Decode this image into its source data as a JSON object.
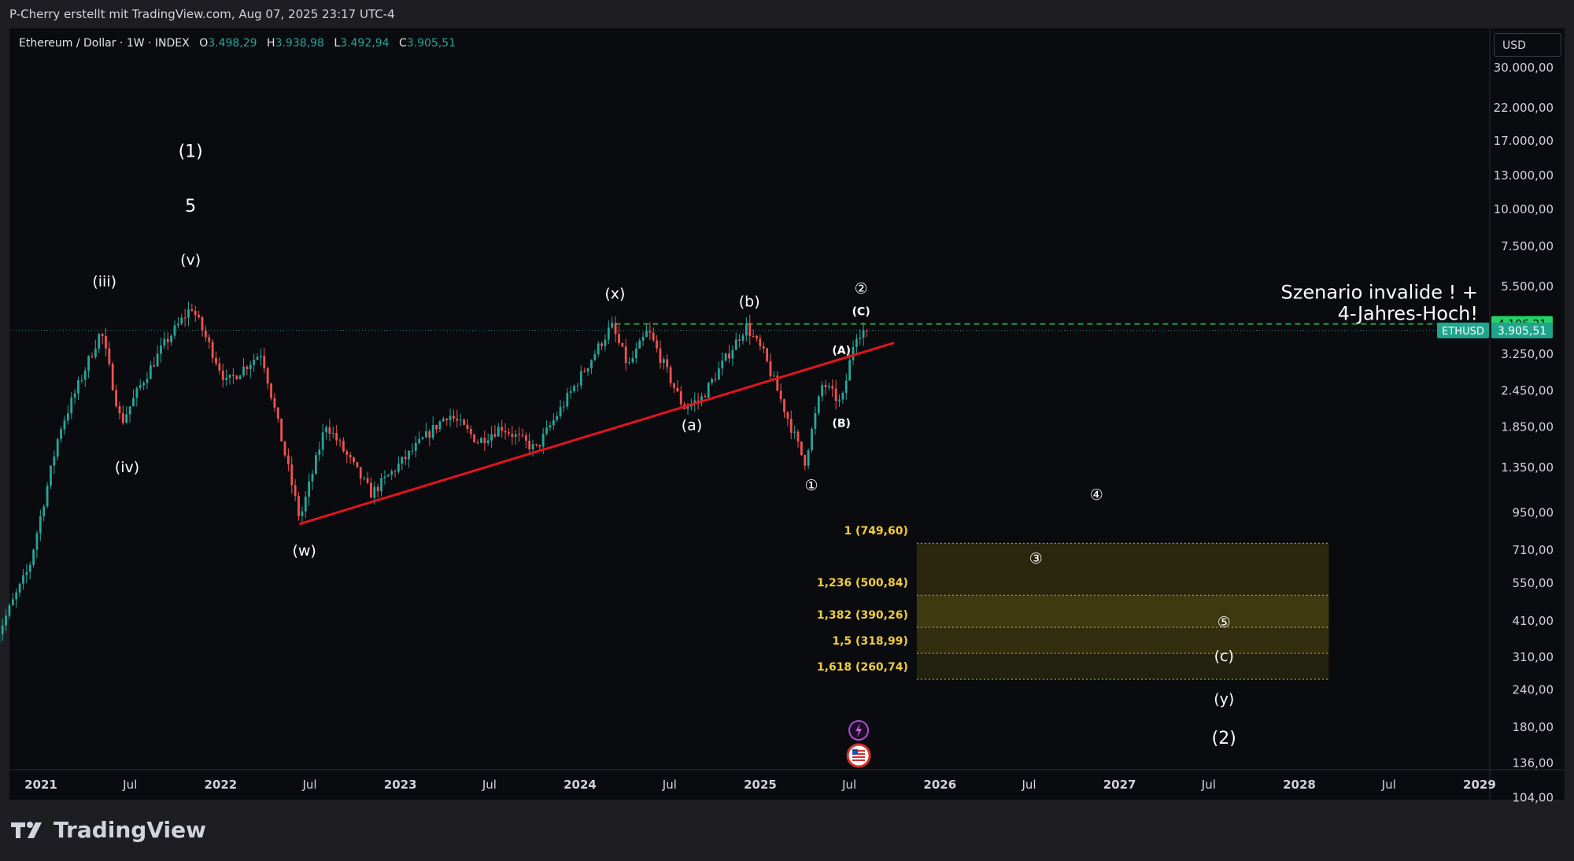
{
  "credit": "P-Cherry erstellt mit TradingView.com, Aug 07, 2025 23:17 UTC-4",
  "brand": "TradingView",
  "header": {
    "symbol": "Ethereum / Dollar · 1W · INDEX",
    "open_label": "O",
    "open": "3.498,29",
    "high_label": "H",
    "high": "3.938,98",
    "low_label": "L",
    "low": "3.492,94",
    "close_label": "C",
    "close": "3.905,51"
  },
  "currency": "USD",
  "colors": {
    "up": "#26a69a",
    "down": "#ef5350",
    "trendline": "#e0141e",
    "fib_zone": "#807010",
    "fib_text": "#f2cc3a",
    "green_line": "#2e9d45",
    "price_tag": "#1fa58c",
    "invalid_tag": "#25d366",
    "panel_bg": "#0a0b0f"
  },
  "chart_data": {
    "type": "candlestick",
    "title": "Ethereum / Dollar · 1W · INDEX",
    "y_scale": "log",
    "ylim": [
      95,
      40000
    ],
    "y_ticks": [
      "30.000,00",
      "22.000,00",
      "17.000,00",
      "13.000,00",
      "10.000,00",
      "7.500,00",
      "5.500,00",
      "3.250,00",
      "2.450,00",
      "1.850,00",
      "1.350,00",
      "950,00",
      "710,00",
      "550,00",
      "410,00",
      "310,00",
      "240,00",
      "180,00",
      "136,00",
      "104,00"
    ],
    "x_ticks": [
      "2021",
      "Jul",
      "2022",
      "Jul",
      "2023",
      "Jul",
      "2024",
      "Jul",
      "2025",
      "Jul",
      "2026",
      "Jul",
      "2027",
      "Jul",
      "2028",
      "Jul",
      "2029"
    ],
    "series_path": [
      [
        "2020-10-01",
        340
      ],
      [
        "2020-12-15",
        620
      ],
      [
        "2021-02-15",
        1800
      ],
      [
        "2021-05-10",
        3900
      ],
      [
        "2021-06-20",
        1900
      ],
      [
        "2021-08-01",
        2600
      ],
      [
        "2021-09-15",
        3500
      ],
      [
        "2021-11-10",
        4700
      ],
      [
        "2022-01-20",
        2600
      ],
      [
        "2022-04-01",
        3300
      ],
      [
        "2022-06-18",
        900
      ],
      [
        "2022-08-10",
        1900
      ],
      [
        "2022-11-10",
        1100
      ],
      [
        "2023-04-15",
        2050
      ],
      [
        "2023-06-15",
        1650
      ],
      [
        "2023-08-01",
        1850
      ],
      [
        "2023-10-10",
        1550
      ],
      [
        "2024-03-12",
        4050
      ],
      [
        "2024-04-15",
        2950
      ],
      [
        "2024-05-25",
        3900
      ],
      [
        "2024-08-05",
        2150
      ],
      [
        "2024-09-10",
        2300
      ],
      [
        "2024-12-10",
        4050
      ],
      [
        "2025-01-15",
        3250
      ],
      [
        "2025-04-08",
        1400
      ],
      [
        "2025-05-15",
        2600
      ],
      [
        "2025-06-22",
        2200
      ],
      [
        "2025-07-20",
        3800
      ],
      [
        "2025-08-07",
        3905.51
      ]
    ],
    "trendline": [
      [
        "2022-06-10",
        870
      ],
      [
        "2025-09-30",
        3550
      ]
    ],
    "last_price": {
      "label": "ETHUSD",
      "value": 3905.51,
      "text": "3.905,51"
    },
    "invalidation": {
      "value": 4106.21,
      "text": "4.106,21",
      "note_line1": "Szenario invalide ! +",
      "note_line2": "4-Jahres-Hoch!"
    },
    "fib_levels": [
      {
        "label": "1 (749,60)",
        "value": 749.6
      },
      {
        "label": "1,236 (500,84)",
        "value": 500.84
      },
      {
        "label": "1,382 (390,26)",
        "value": 390.26
      },
      {
        "label": "1,5 (318,99)",
        "value": 318.99
      },
      {
        "label": "1,618 (260,74)",
        "value": 260.74
      }
    ],
    "fib_zone_dates": [
      "2025-11-15",
      "2028-03-01"
    ],
    "wave_labels": [
      {
        "text": "(1)",
        "date": "2021-11-01",
        "value": 15000
      },
      {
        "text": "5",
        "date": "2021-11-01",
        "value": 9800
      },
      {
        "text": "(v)",
        "date": "2021-11-01",
        "value": 6500
      },
      {
        "text": "(iii)",
        "date": "2021-05-10",
        "value": 5500
      },
      {
        "text": "(iv)",
        "date": "2021-06-25",
        "value": 1300
      },
      {
        "text": "(w)",
        "date": "2022-06-20",
        "value": 680
      },
      {
        "text": "(x)",
        "date": "2024-03-12",
        "value": 5000
      },
      {
        "text": "(a)",
        "date": "2024-08-15",
        "value": 1800
      },
      {
        "text": "(b)",
        "date": "2024-12-10",
        "value": 4700
      },
      {
        "text": "②",
        "date": "2025-07-25",
        "value": 5200
      },
      {
        "text": "(C)",
        "date": "2025-07-25",
        "value": 4400
      },
      {
        "text": "(A)",
        "date": "2025-06-15",
        "value": 3250
      },
      {
        "text": "(B)",
        "date": "2025-06-15",
        "value": 1850
      },
      {
        "text": "①",
        "date": "2025-04-15",
        "value": 1130
      },
      {
        "text": "④",
        "date": "2026-11-15",
        "value": 1050
      },
      {
        "text": "③",
        "date": "2026-07-15",
        "value": 640
      },
      {
        "text": "⑤",
        "date": "2027-08-01",
        "value": 390
      },
      {
        "text": "(c)",
        "date": "2027-08-01",
        "value": 300
      },
      {
        "text": "(y)",
        "date": "2027-08-01",
        "value": 215
      },
      {
        "text": "(2)",
        "date": "2027-08-01",
        "value": 158
      }
    ]
  }
}
